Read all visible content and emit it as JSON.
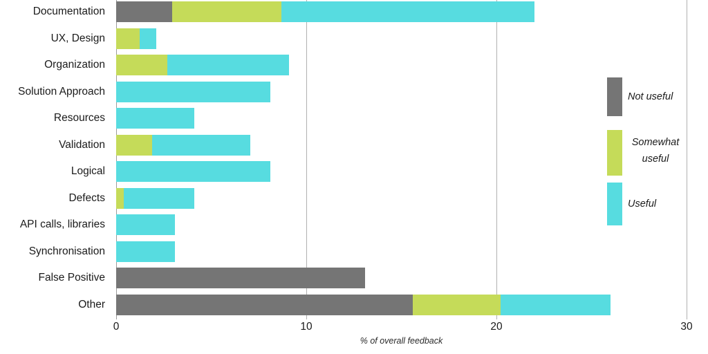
{
  "chart_data": {
    "type": "bar",
    "orientation": "horizontal",
    "stacked": true,
    "title": "",
    "xlabel": "% of overall feedback",
    "ylabel": "",
    "xlim": [
      0,
      30
    ],
    "xticks": [
      0,
      10,
      20,
      30
    ],
    "xtick_labels": [
      "0",
      "10",
      "20",
      "30"
    ],
    "grid": true,
    "grid_axis": "x",
    "legend_position": "right",
    "categories": [
      "Documentation",
      "UX, Design",
      "Organization",
      "Solution Approach",
      "Resources",
      "Validation",
      "Logical",
      "Defects",
      "API calls, libraries",
      "Synchronisation",
      "False Positive",
      "Other"
    ],
    "series": [
      {
        "name": "Not useful",
        "color": "#757575",
        "values": [
          2.95,
          0,
          0,
          0,
          0,
          0,
          0,
          0,
          0,
          0,
          13.1,
          15.6
        ]
      },
      {
        "name": "Somewhat useful",
        "color": "#c5db59",
        "values": [
          5.75,
          1.25,
          2.7,
          0,
          0,
          1.9,
          0,
          0.4,
          0,
          0,
          0,
          4.6
        ]
      },
      {
        "name": "Useful",
        "color": "#57dce0",
        "values": [
          13.3,
          0.85,
          6.4,
          8.1,
          4.1,
          5.15,
          8.1,
          3.7,
          3.1,
          3.1,
          0,
          5.8
        ]
      }
    ],
    "totals": [
      22.0,
      2.1,
      9.1,
      8.1,
      4.1,
      7.05,
      8.1,
      4.1,
      3.1,
      3.1,
      13.1,
      26.0
    ]
  },
  "legend": {
    "items": [
      {
        "label": "Not useful",
        "color": "#757575"
      },
      {
        "label": "Somewhat useful",
        "color": "#c5db59"
      },
      {
        "label": "Useful",
        "color": "#57dce0"
      }
    ]
  },
  "colors": {
    "not_useful": "#757575",
    "somewhat_useful": "#c5db59",
    "useful": "#57dce0",
    "gridline": "#b0b0b0",
    "background": "#ffffff",
    "text": "#1a1a1a"
  }
}
